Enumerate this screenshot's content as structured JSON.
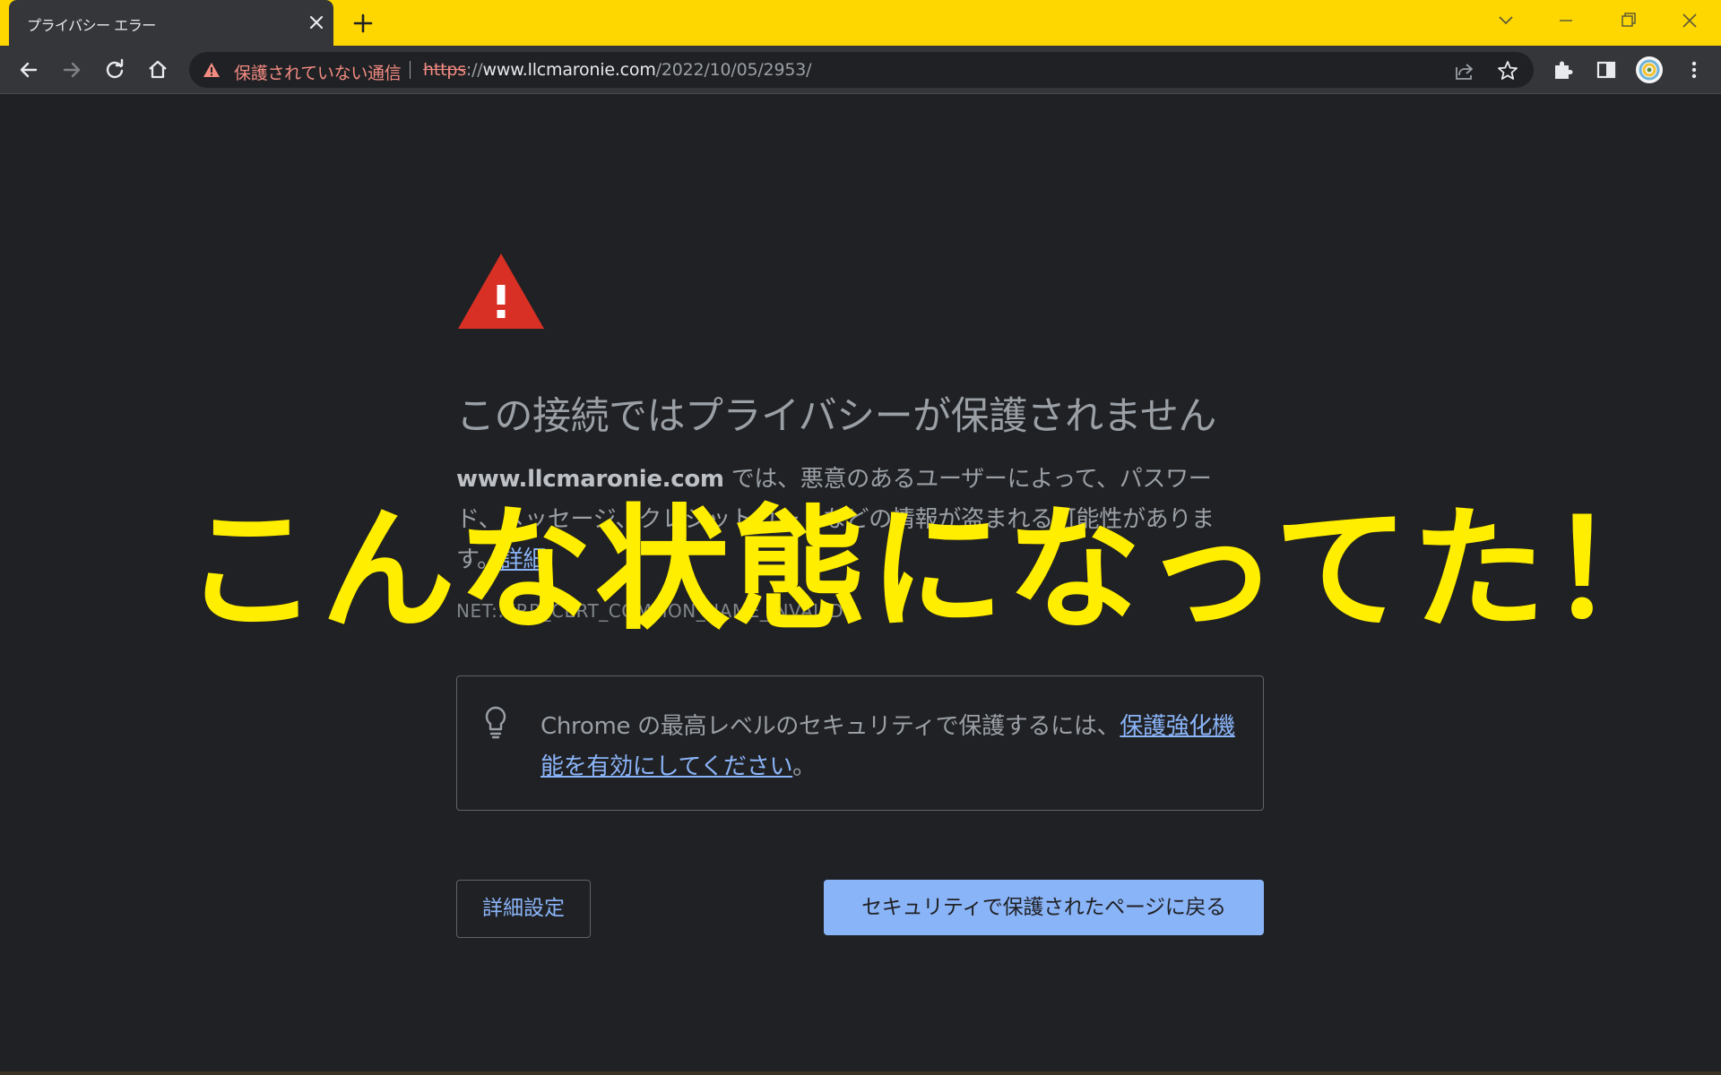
{
  "tab": {
    "title": "プライバシー エラー"
  },
  "omnibox": {
    "security_label": "保護されていない通信",
    "url_scheme": "https",
    "url_sep": "://",
    "url_host": "www.llcmaronie.com",
    "url_path": "/2022/10/05/2953/"
  },
  "content": {
    "heading": "この接続ではプライバシーが保護されません",
    "body_domain": "www.llcmaronie.com",
    "body_text": " では、悪意のあるユーザーによって、パスワード、メッセージ、クレジットカードなどの情報が盗まれる可能性があります。",
    "details_link": "詳細",
    "error_code": "NET::ERR_CERT_COMMON_NAME_INVALID",
    "promo_text": "Chrome の最高レベルのセキュリティで保護するには、",
    "promo_link": "保護強化機能を有効にしてください",
    "promo_end": "。",
    "details_button": "詳細設定",
    "back_button": "セキュリティで保護されたページに戻る"
  },
  "overlay": {
    "caption": "こんな状態になってた！"
  },
  "colors": {
    "tabstrip": "#fed700",
    "toolbar": "#35363a",
    "page_bg": "#202124",
    "insecure_red": "#f28b82",
    "link_blue": "#8ab4f8",
    "caption_yellow": "#ffee00",
    "alert_red": "#d93025"
  }
}
